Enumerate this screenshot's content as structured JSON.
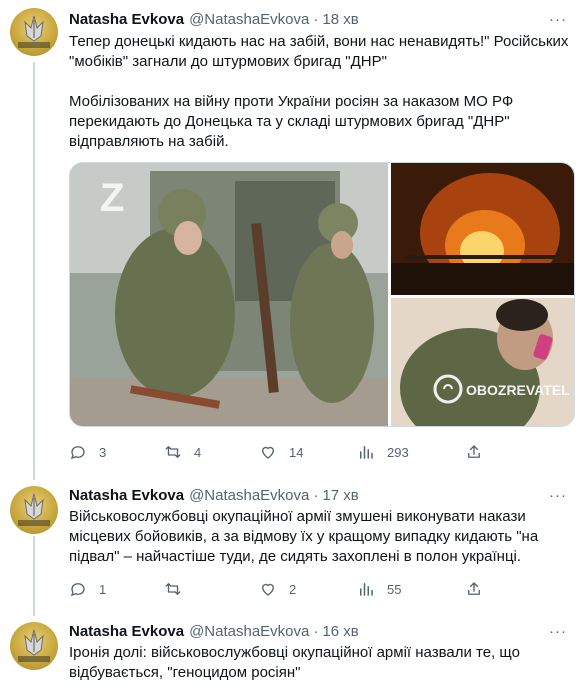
{
  "tweets": [
    {
      "name": "Natasha Evkova",
      "handle": "@NatashaEvkova",
      "time": "18 хв",
      "paragraphs": [
        "Тепер донецькі кидають нас на забій, вони нас ненавидять!\" Російських \"мобіків\" загнали до штурмових бригад \"ДНР\"",
        "Мобілізованих на війну проти України росіян за наказом МО РФ перекидають до Донецька та у складі штурмових бригад \"ДНР\" відправляють на забій."
      ],
      "media": {
        "watermark": "OBOZREVATEL"
      },
      "actions": {
        "replies": "3",
        "retweets": "4",
        "likes": "14",
        "views": "293"
      }
    },
    {
      "name": "Natasha Evkova",
      "handle": "@NatashaEvkova",
      "time": "17 хв",
      "paragraphs": [
        "Військовослужбовці окупаційної армії змушені виконувати накази місцевих бойовиків, а за відмову їх у кращому випадку кидають \"на підвал\" – найчастіше туди, де сидять захоплені в полон українці."
      ],
      "actions": {
        "replies": "1",
        "retweets": "",
        "likes": "2",
        "views": "55"
      }
    },
    {
      "name": "Natasha Evkova",
      "handle": "@NatashaEvkova",
      "time": "16 хв",
      "paragraphs": [
        "Іронія долі: військовослужбовці окупаційної армії назвали те, що відбувається, \"геноцидом росіян\""
      ]
    }
  ],
  "separator": "·",
  "more_glyph": "···",
  "colors": {
    "text": "#0f1419",
    "secondary": "#536471",
    "thread_line": "#cfd9de",
    "avatar_gold": "#c9a83f"
  },
  "icons": [
    "reply-icon",
    "retweet-icon",
    "like-icon",
    "views-icon",
    "share-icon",
    "more-icon"
  ]
}
